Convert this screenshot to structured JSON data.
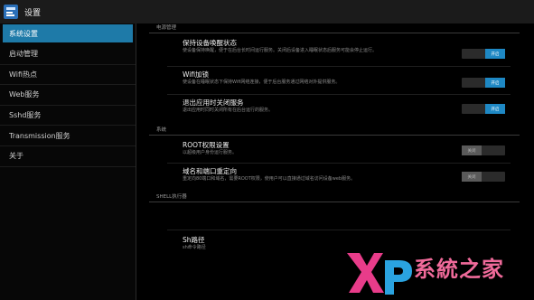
{
  "title": "设置",
  "sidebar": {
    "items": [
      {
        "label": "系统设置",
        "active": true
      },
      {
        "label": "启动管理",
        "active": false
      },
      {
        "label": "Wifi热点",
        "active": false
      },
      {
        "label": "Web服务",
        "active": false
      },
      {
        "label": "Sshd服务",
        "active": false
      },
      {
        "label": "Transmission服务",
        "active": false
      },
      {
        "label": "关于",
        "active": false
      }
    ]
  },
  "sections": {
    "power": {
      "header": "电源管理",
      "rows": [
        {
          "title": "保持设备唤醒状态",
          "desc": "使设备保持唤醒，便于在后台长时间运行服务。关闭后设备进入睡眠状态后服务可能会停止运行。",
          "toggle": "开启"
        },
        {
          "title": "Wifi加锁",
          "desc": "使设备在睡眠状态下保持Wifi网络连接，便于后台服务通过网络对外提供服务。",
          "toggle": "开启"
        },
        {
          "title": "退出应用时关闭服务",
          "desc": "退出应用时同时关闭所有在后台运行的服务。",
          "toggle": "开启"
        }
      ]
    },
    "system": {
      "header": "系统",
      "rows": [
        {
          "title": "ROOT权限设置",
          "desc": "以超级用户身份运行服务。",
          "toggle": "关闭"
        },
        {
          "title": "域名和端口重定向",
          "desc": "重定向80端口和域名，需要ROOT权限，使用户可以直接通过域名访问设备web服务。",
          "toggle": "关闭"
        }
      ]
    },
    "shell": {
      "header": "SHELL执行器",
      "rows": [
        {
          "title": "",
          "desc": ""
        },
        {
          "title": "Sh路径",
          "desc": "sh命令路径"
        }
      ]
    }
  },
  "watermark": {
    "text": "系統之家",
    "brand": "Xp"
  },
  "colors": {
    "accent": "#1e7aa8",
    "toggle_on": "#1e88c4",
    "watermark": "#f06a9a"
  }
}
